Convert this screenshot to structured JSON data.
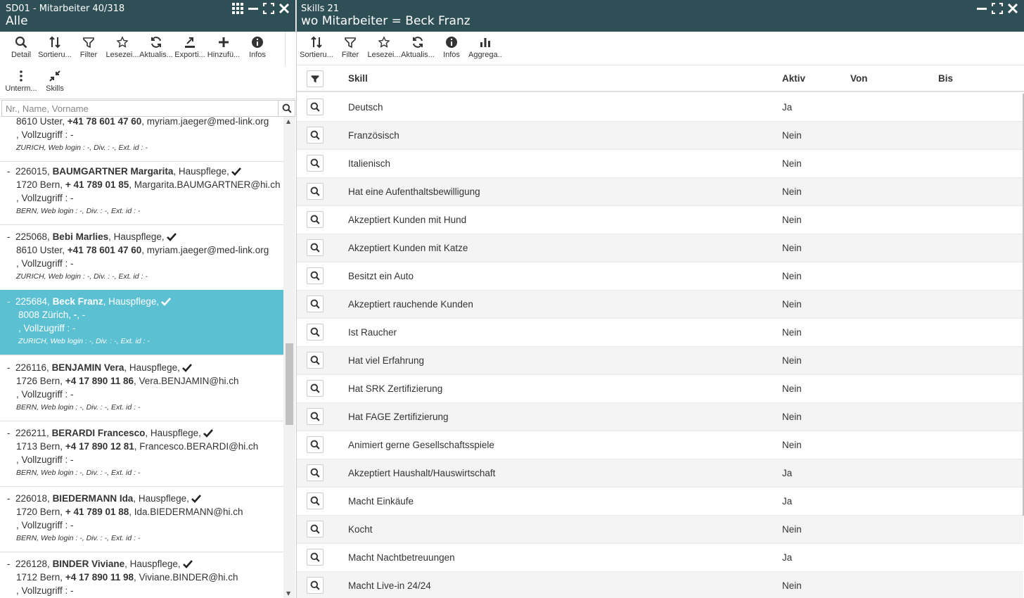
{
  "left": {
    "title_small": "SD01 - Mitarbeiter 40/318",
    "title_big": "Alle",
    "toolbar": [
      {
        "label": "Detail",
        "icon": "search-icon"
      },
      {
        "label": "Sortieru...",
        "icon": "sort-icon"
      },
      {
        "label": "Filter",
        "icon": "filter-icon"
      },
      {
        "label": "Lesezei...",
        "icon": "star-icon"
      },
      {
        "label": "Aktualis...",
        "icon": "refresh-icon"
      },
      {
        "label": "Exporti...",
        "icon": "export-icon"
      },
      {
        "label": "Hinzufü...",
        "icon": "plus-icon"
      },
      {
        "label": "Infos",
        "icon": "info-icon"
      }
    ],
    "toolbar2": [
      {
        "label": "Unterm...",
        "icon": "more-vertical-icon"
      },
      {
        "label": "Skills",
        "icon": "compress-icon"
      }
    ],
    "search_placeholder": "Nr., Name, Vorname",
    "employees": [
      {
        "id": "",
        "name": "",
        "role": "",
        "city": "8610 Uster, ",
        "phone": "+41 78 601 47 60",
        "email": ", myriam.jaeger@med-link.org",
        "access": ", Vollzugriff : -",
        "meta": "ZURICH, Web login : -, Div. : -, Ext. id : -"
      },
      {
        "id": "226015, ",
        "name": "BAUMGARTNER Margarita",
        "role": ", Hauspflege,",
        "city": "1720 Bern, ",
        "phone": "+ 41 789 01 85",
        "email": ", Margarita.BAUMGARTNER@hi.ch",
        "access": ", Vollzugriff : -",
        "meta": "BERN, Web login : -, Div. : -, Ext. id : -"
      },
      {
        "id": "225068, ",
        "name": "Bebi Marlies",
        "role": ", Hauspflege,",
        "city": "8610 Uster, ",
        "phone": "+41 78 601 47 60",
        "email": ", myriam.jaeger@med-link.org",
        "access": ", Vollzugriff : -",
        "meta": "ZURICH, Web login : -, Div. : -, Ext. id : -"
      },
      {
        "id": "225684, ",
        "name": "Beck Franz",
        "role": ", Hauspflege,",
        "city": "8008 Zürich, ",
        "phone": "-",
        "email": ", -",
        "access": ", Vollzugriff : -",
        "meta": "ZURICH, Web login : -, Div. : -, Ext. id : -"
      },
      {
        "id": "226116, ",
        "name": "BENJAMIN Vera",
        "role": ", Hauspflege,",
        "city": "1726 Bern, ",
        "phone": "+4 17 890 11 86",
        "email": ", Vera.BENJAMIN@hi.ch",
        "access": ", Vollzugriff : -",
        "meta": "BERN, Web login : -, Div. : -, Ext. id : -"
      },
      {
        "id": "226211, ",
        "name": "BERARDI Francesco",
        "role": ", Hauspflege,",
        "city": "1713 Bern, ",
        "phone": "+4 17 890 12 81",
        "email": ", Francesco.BERARDI@hi.ch",
        "access": ", Vollzugriff : -",
        "meta": "BERN, Web login : -, Div. : -, Ext. id : -"
      },
      {
        "id": "226018, ",
        "name": "BIEDERMANN Ida",
        "role": ", Hauspflege,",
        "city": "1720 Bern, ",
        "phone": "+ 41 789 01 88",
        "email": ", Ida.BIEDERMANN@hi.ch",
        "access": ", Vollzugriff : -",
        "meta": "BERN, Web login : -, Div. : -, Ext. id : -"
      },
      {
        "id": "226128, ",
        "name": "BINDER Viviane",
        "role": ", Hauspflege,",
        "city": "1712 Bern, ",
        "phone": "+4 17 890 11 98",
        "email": ", Viviane.BINDER@hi.ch",
        "access": ", Vollzugriff : -",
        "meta": ""
      }
    ]
  },
  "right": {
    "title_small": "Skills 21",
    "title_big": "wo Mitarbeiter = Beck Franz",
    "toolbar": [
      {
        "label": "Sortieru...",
        "icon": "sort-icon"
      },
      {
        "label": "Filter",
        "icon": "filter-icon"
      },
      {
        "label": "Lesezei...",
        "icon": "star-icon"
      },
      {
        "label": "Aktualis...",
        "icon": "refresh-icon"
      },
      {
        "label": "Infos",
        "icon": "info-icon"
      },
      {
        "label": "Aggrega...",
        "icon": "bar-chart-icon"
      }
    ],
    "columns": {
      "skill": "Skill",
      "aktiv": "Aktiv",
      "von": "Von",
      "bis": "Bis"
    },
    "rows": [
      {
        "skill": "Deutsch",
        "aktiv": "Ja"
      },
      {
        "skill": "Französisch",
        "aktiv": "Nein"
      },
      {
        "skill": "Italienisch",
        "aktiv": "Nein"
      },
      {
        "skill": "Hat eine Aufenthaltsbewilligung",
        "aktiv": "Nein"
      },
      {
        "skill": "Akzeptiert Kunden mit Hund",
        "aktiv": "Nein"
      },
      {
        "skill": "Akzeptiert Kunden mit Katze",
        "aktiv": "Nein"
      },
      {
        "skill": "Besitzt ein Auto",
        "aktiv": "Nein"
      },
      {
        "skill": "Akzeptiert rauchende Kunden",
        "aktiv": "Nein"
      },
      {
        "skill": "Ist Raucher",
        "aktiv": "Nein"
      },
      {
        "skill": "Hat viel Erfahrung",
        "aktiv": "Nein"
      },
      {
        "skill": "Hat SRK Zertifizierung",
        "aktiv": "Nein"
      },
      {
        "skill": "Hat FAGE Zertifizierung",
        "aktiv": "Nein"
      },
      {
        "skill": "Animiert gerne Gesellschaftsspiele",
        "aktiv": "Nein"
      },
      {
        "skill": "Akzeptiert Haushalt/Hauswirtschaft",
        "aktiv": "Ja"
      },
      {
        "skill": "Macht Einkäufe",
        "aktiv": "Ja"
      },
      {
        "skill": "Kocht",
        "aktiv": "Nein"
      },
      {
        "skill": "Macht Nachtbetreuungen",
        "aktiv": "Ja"
      },
      {
        "skill": "Macht Live-in 24/24",
        "aktiv": "Nein"
      }
    ]
  },
  "colors": {
    "header_bg": "#2e4f55",
    "selected_bg": "#5bc0d2"
  }
}
